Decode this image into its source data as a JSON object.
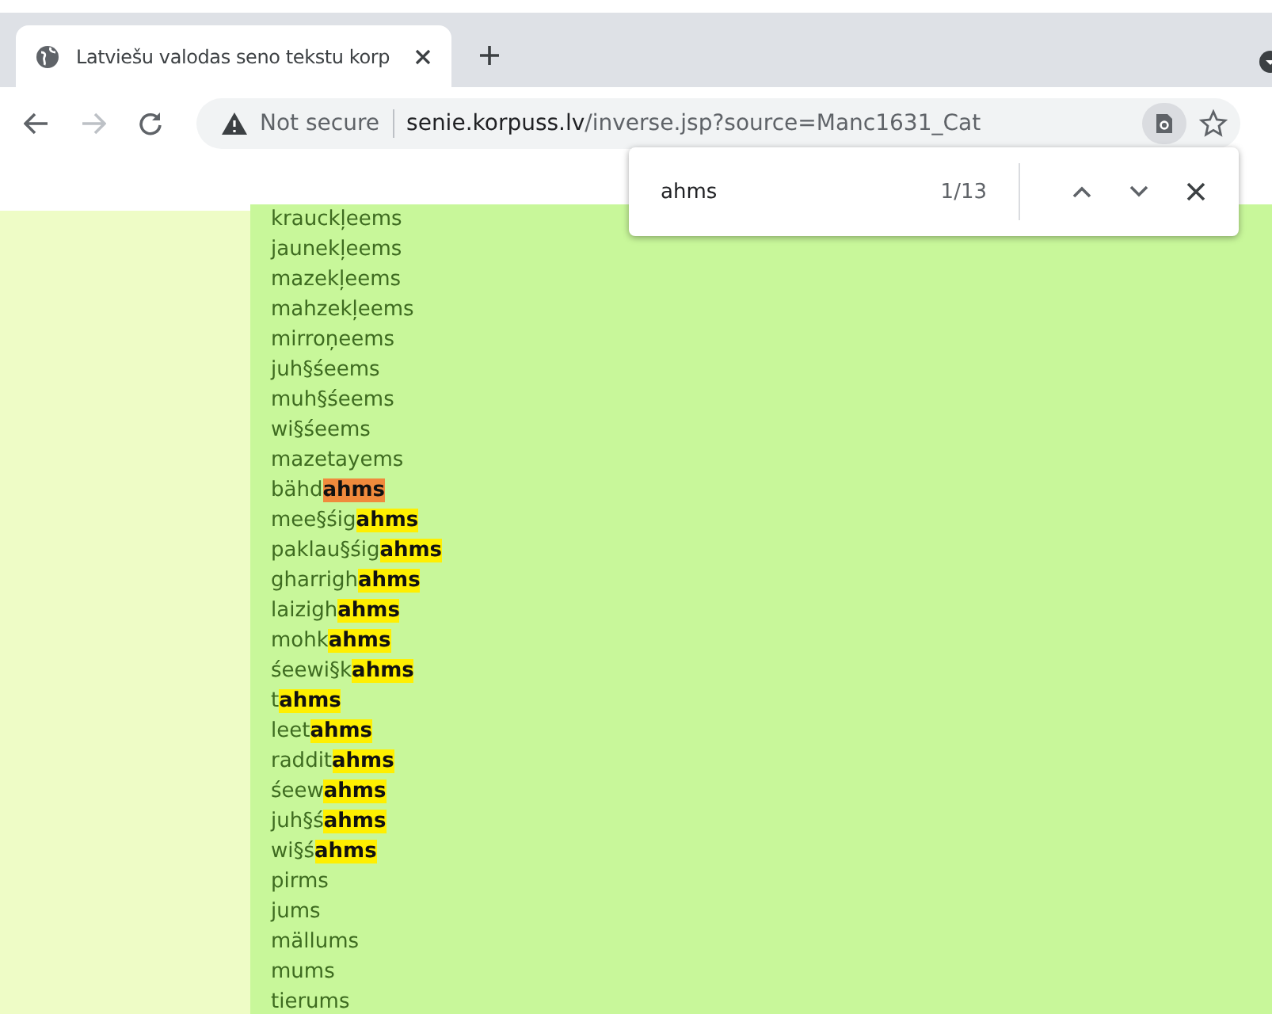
{
  "browser": {
    "tab": {
      "title": "Latviešu valodas seno tekstu korp",
      "selected": true
    },
    "address": {
      "security": "Not secure",
      "url": "senie.korpuss.lv/inverse.jsp?source=Manc1631_Cat"
    }
  },
  "find_bar": {
    "query": "ahms",
    "count": "1/13"
  },
  "words": [
    {
      "kind": "plain",
      "text": "krauckļeems"
    },
    {
      "kind": "plain",
      "text": "jaunekļeems"
    },
    {
      "kind": "plain",
      "text": "mazekļeems"
    },
    {
      "kind": "plain",
      "text": "mahzekļeems"
    },
    {
      "kind": "plain",
      "text": "mirroņeems"
    },
    {
      "kind": "plain",
      "text": "juh§śeems"
    },
    {
      "kind": "plain",
      "text": "muh§śeems"
    },
    {
      "kind": "plain",
      "text": "wi§śeems"
    },
    {
      "kind": "plain",
      "text": "mazetayems"
    },
    {
      "kind": "hit",
      "text": "bähd",
      "match": "ahms",
      "current": true
    },
    {
      "kind": "hit",
      "text": "mee§śig",
      "match": "ahms",
      "current": false
    },
    {
      "kind": "hit",
      "text": "paklau§śig",
      "match": "ahms",
      "current": false
    },
    {
      "kind": "hit",
      "text": "gharrigh",
      "match": "ahms",
      "current": false
    },
    {
      "kind": "hit",
      "text": "laizigh",
      "match": "ahms",
      "current": false
    },
    {
      "kind": "hit",
      "text": "mohk",
      "match": "ahms",
      "current": false
    },
    {
      "kind": "hit",
      "text": "śeewi§k",
      "match": "ahms",
      "current": false
    },
    {
      "kind": "hit",
      "text": "t",
      "match": "ahms",
      "current": false
    },
    {
      "kind": "hit",
      "text": "leet",
      "match": "ahms",
      "current": false
    },
    {
      "kind": "hit",
      "text": "raddit",
      "match": "ahms",
      "current": false
    },
    {
      "kind": "hit",
      "text": "śeew",
      "match": "ahms",
      "current": false
    },
    {
      "kind": "hit",
      "text": "juh§ś",
      "match": "ahms",
      "current": false
    },
    {
      "kind": "hit",
      "text": "wi§ś",
      "match": "ahms",
      "current": false
    },
    {
      "kind": "plain",
      "text": "pirms"
    },
    {
      "kind": "plain",
      "text": "jums"
    },
    {
      "kind": "plain",
      "text": "mällums"
    },
    {
      "kind": "plain",
      "text": "mums"
    },
    {
      "kind": "plain",
      "text": "tierums"
    }
  ]
}
